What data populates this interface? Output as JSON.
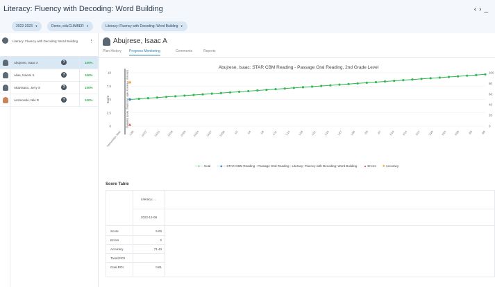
{
  "header": {
    "title": "Literacy: Fluency with Decoding: Word Building",
    "prev_label": "‹",
    "next_label": "›",
    "minimize_label": "_"
  },
  "filters": {
    "year": "2022-2023",
    "school": "Demo, eduCLIMBER",
    "intervention": "Literacy: Fluency with Decoding: Word Building"
  },
  "sidebar": {
    "header_text": "Literacy: Fluency with Decoding: Word Building",
    "students": [
      {
        "name": "Abujrese, Isaac A",
        "percent": "100%",
        "selected": true,
        "avatar": "person-icon"
      },
      {
        "name": "Alias, Naomi X",
        "percent": "100%",
        "selected": false,
        "avatar": "person-icon"
      },
      {
        "name": "Attanisano, Jerry S",
        "percent": "100%",
        "selected": false,
        "avatar": "person-icon"
      },
      {
        "name": "Anzinovski, Niki R",
        "percent": "100%",
        "selected": false,
        "avatar": "photo-avatar"
      }
    ]
  },
  "student": {
    "name": "Abujrese, Isaac A",
    "tabs": [
      {
        "label": "Plan History",
        "active": false
      },
      {
        "label": "Progress Monitoring",
        "active": true
      },
      {
        "label": "Comments",
        "active": false
      },
      {
        "label": "Reports",
        "active": false
      }
    ]
  },
  "chart_data": {
    "type": "line",
    "title": "Abujrese, Isaac: STAR CBM Reading - Passage Oral Reading, 2nd Grade Level",
    "ylabel": "Score",
    "ylim": [
      0,
      10
    ],
    "yticks": [
      "0",
      "2.5",
      "5",
      "7.5",
      "10"
    ],
    "right_ticks": [
      "0",
      "20",
      "40",
      "60",
      "80",
      "100"
    ],
    "x_ticks": [
      "Intervention Start",
      "12/8",
      "12/12",
      "12/15",
      "12/18",
      "12/20",
      "12/24",
      "12/27",
      "12/30",
      "1/2",
      "1/4",
      "1/8",
      "1/11",
      "1/14",
      "1/18",
      "1/21",
      "1/24",
      "1/27",
      "1/30",
      "2/3",
      "2/7",
      "2/10",
      "2/14",
      "2/17",
      "2/20",
      "2/24",
      "2/28",
      "3/3",
      "3/8"
    ],
    "phase_label": "Literacy: Fluency with Decoding: Word Building",
    "colors": {
      "goal": "#2eb84f",
      "star": "#3c86c9",
      "errors": "#d9534f",
      "accuracy": "#f0a030"
    },
    "series": [
      {
        "name": "Goal",
        "start": 5.0,
        "end": 9.7,
        "points": 40
      },
      {
        "name": "STAR CBM Reading - Passage Oral Reading - Literacy: Fluency with Decoding: Word Building",
        "x_index": 0,
        "value": 5.0
      },
      {
        "name": "Errors",
        "x_index": 0,
        "value": 0.2
      },
      {
        "name": "Accuracy",
        "x_index": 0,
        "value": 8.2
      }
    ]
  },
  "score_table": {
    "title": "Score Table",
    "column_header": "Literacy: ...",
    "column_date": "2022-12-08",
    "rows": [
      {
        "label": "Score",
        "value": "5.00"
      },
      {
        "label": "Errors",
        "value": "2"
      },
      {
        "label": "Accuracy",
        "value": "71.43"
      },
      {
        "label": "Trend ROI",
        "value": ""
      },
      {
        "label": "Goal ROI",
        "value": "0.61"
      }
    ]
  }
}
